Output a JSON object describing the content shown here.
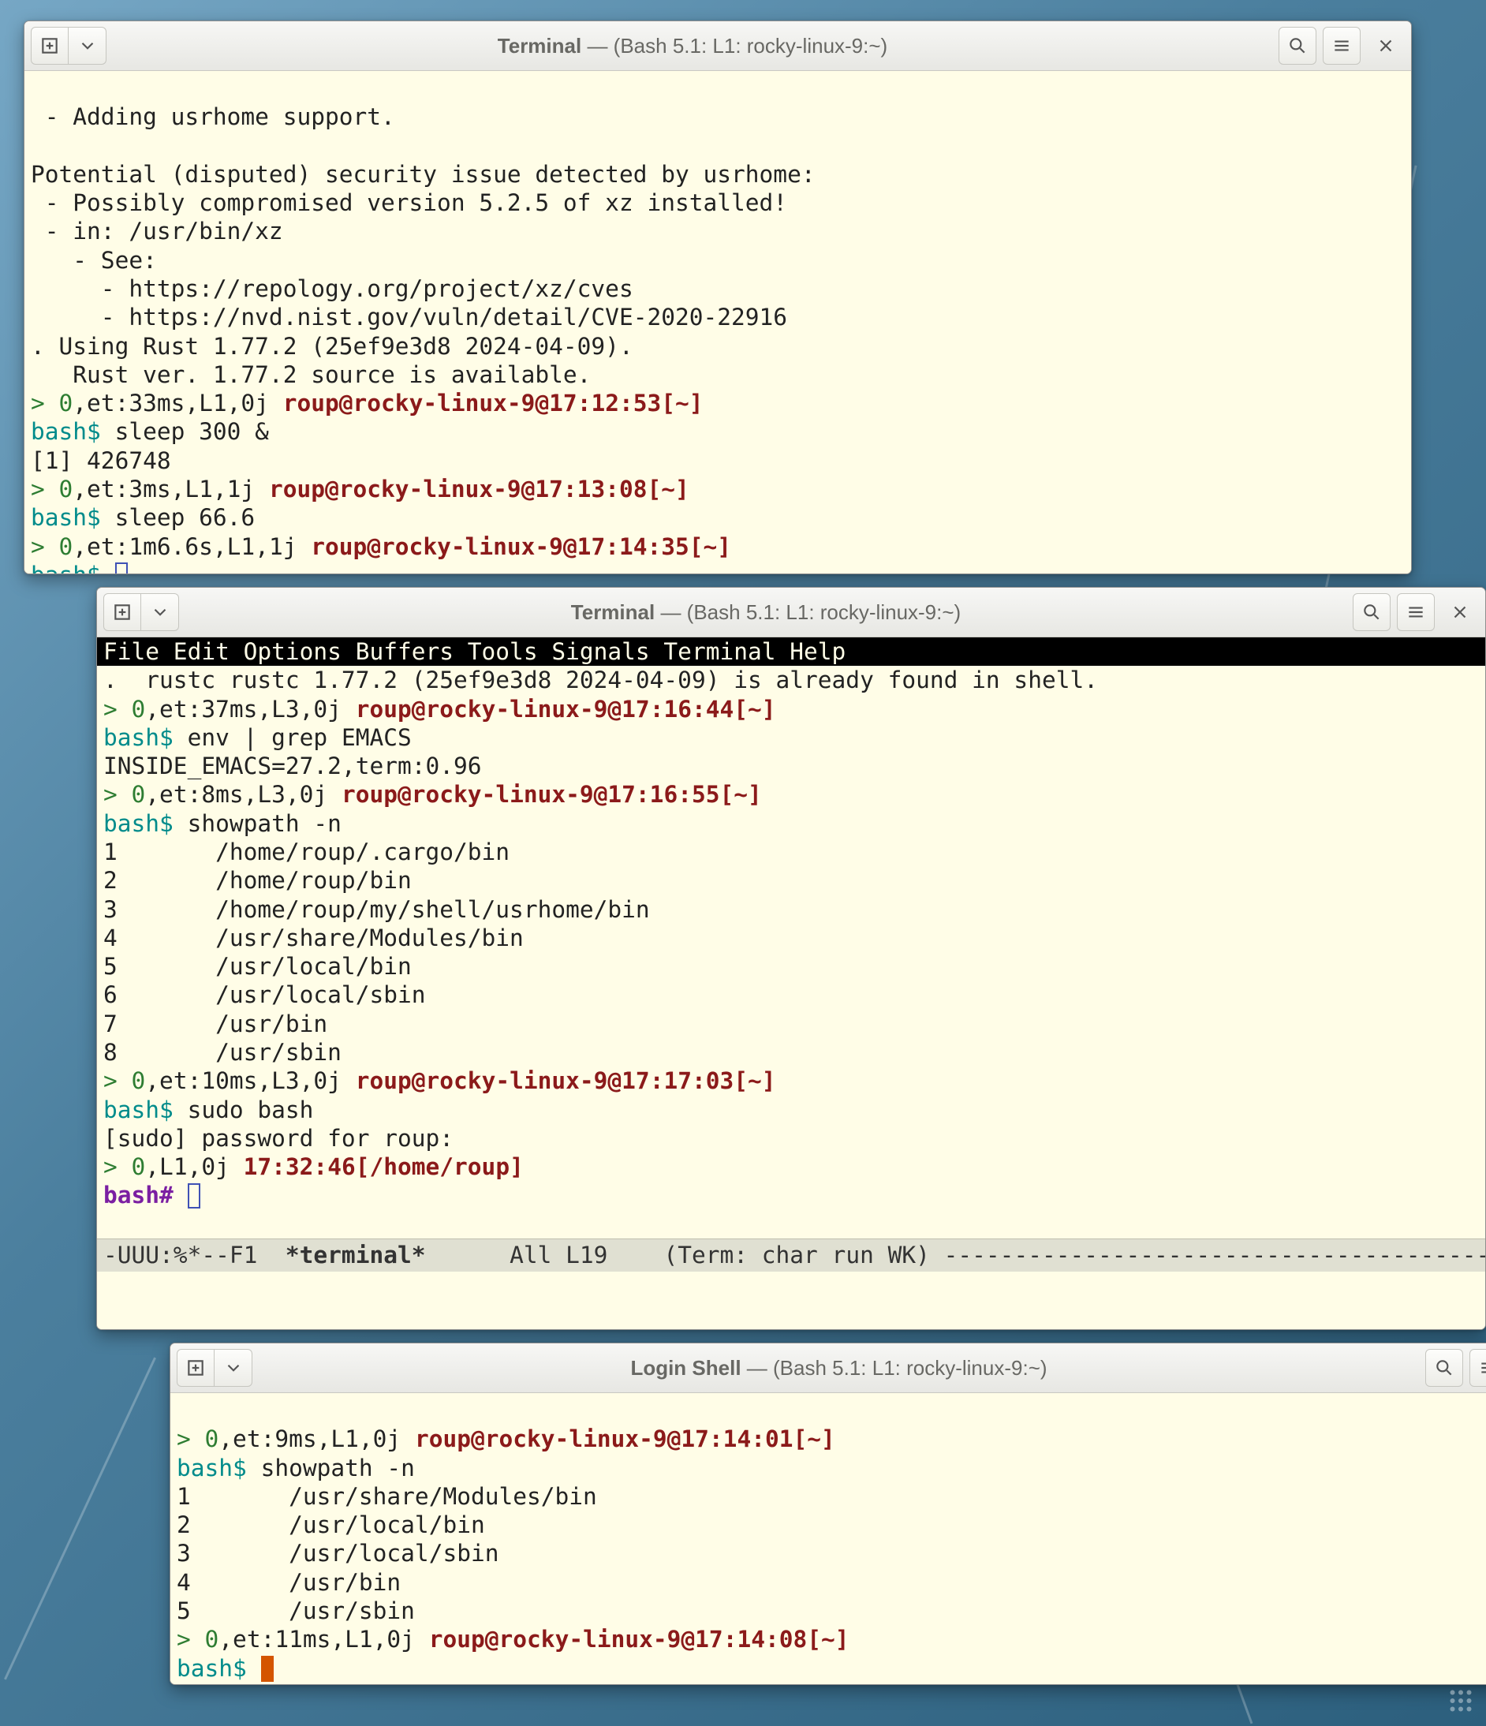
{
  "windows": {
    "w1": {
      "title_prefix": "Terminal",
      "title_sep": " — ",
      "title_rest": "(Bash 5.1: L1: rocky-linux-9:~)",
      "lines": {
        "l0": " - Adding usrhome support.",
        "l1": "Potential (disputed) security issue detected by usrhome:",
        "l2": " - Possibly compromised version 5.2.5 of xz installed!",
        "l3": " - in: /usr/bin/xz",
        "l4": "   - See:",
        "l5": "     - https://repology.org/project/xz/cves",
        "l6": "     - https://nvd.nist.gov/vuln/detail/CVE-2020-22916",
        "l7": ". Using Rust 1.77.2 (25ef9e3d8 2024-04-09).",
        "l8": "   Rust ver. 1.77.2 source is available.",
        "p1a": "> 0",
        "p1b": ",et:33ms,L1,0j ",
        "p1c": "roup@rocky-linux-9@17:12:53[~]",
        "bashd": "bash$",
        "cmd1": " sleep 300 &",
        "job1": "[1] 426748",
        "p2a": "> 0",
        "p2b": ",et:3ms,L1,1j ",
        "p2c": "roup@rocky-linux-9@17:13:08[~]",
        "cmd2": " sleep 66.6",
        "p3a": "> 0",
        "p3b": ",et:1m6.6s,L1,1j ",
        "p3c": "roup@rocky-linux-9@17:14:35[~]"
      }
    },
    "w2": {
      "title_prefix": "Terminal",
      "title_sep": " — ",
      "title_rest": "(Bash 5.1: L1: rocky-linux-9:~)",
      "menubar": "File Edit Options Buffers Tools Signals Terminal Help",
      "lines": {
        "l0": ".  rustc rustc 1.77.2 (25ef9e3d8 2024-04-09) is already found in shell.",
        "p1a": "> 0",
        "p1b": ",et:37ms,L3,0j ",
        "p1c": "roup@rocky-linux-9@17:16:44[~]",
        "bashd": "bash$",
        "cmd1": " env | grep EMACS",
        "out1": "INSIDE_EMACS=27.2,term:0.96",
        "p2a": "> 0",
        "p2b": ",et:8ms,L3,0j ",
        "p2c": "roup@rocky-linux-9@17:16:55[~]",
        "cmd2": " showpath -n",
        "sp1": "1       /home/roup/.cargo/bin",
        "sp2": "2       /home/roup/bin",
        "sp3": "3       /home/roup/my/shell/usrhome/bin",
        "sp4": "4       /usr/share/Modules/bin",
        "sp5": "5       /usr/local/bin",
        "sp6": "6       /usr/local/sbin",
        "sp7": "7       /usr/bin",
        "sp8": "8       /usr/sbin",
        "p3a": "> 0",
        "p3b": ",et:10ms,L3,0j ",
        "p3c": "roup@rocky-linux-9@17:17:03[~]",
        "cmd3": " sudo bash",
        "sudo": "[sudo] password for roup:",
        "p4a": "> 0",
        "p4b": ",L1,0j ",
        "p4c": "17:32:46[/home/roup]",
        "bashh": "bash#"
      },
      "modeline_left": "-UUU:%*--F1  ",
      "modeline_term": "*terminal*",
      "modeline_mid": "      All L19    (Term: char run WK) ",
      "modeline_dashes": "-------------------------------------------"
    },
    "w3": {
      "title_prefix": "Login Shell",
      "title_sep": " — ",
      "title_rest": "(Bash 5.1: L1: rocky-linux-9:~)",
      "lines": {
        "p1a": "> 0",
        "p1b": ",et:9ms,L1,0j ",
        "p1c": "roup@rocky-linux-9@17:14:01[~]",
        "bashd": "bash$",
        "cmd1": " showpath -n",
        "sp1": "1       /usr/share/Modules/bin",
        "sp2": "2       /usr/local/bin",
        "sp3": "3       /usr/local/sbin",
        "sp4": "4       /usr/bin",
        "sp5": "5       /usr/sbin",
        "p2a": "> 0",
        "p2b": ",et:11ms,L1,0j ",
        "p2c": "roup@rocky-linux-9@17:14:08[~]"
      }
    }
  },
  "icons": {
    "new_tab": "new-tab-icon",
    "menu_arrow": "chevron-down-icon",
    "search": "search-icon",
    "hamburger": "hamburger-icon",
    "close": "close-icon"
  }
}
